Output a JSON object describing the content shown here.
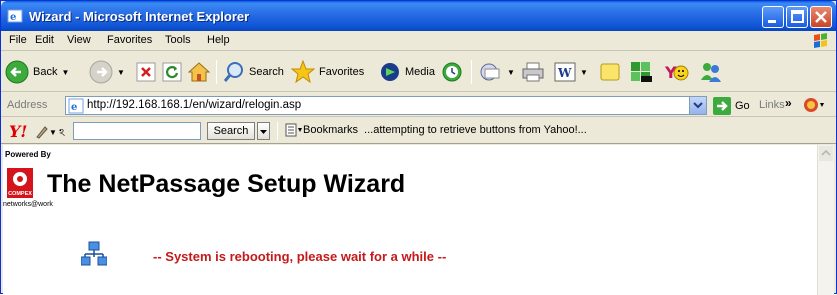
{
  "window": {
    "title": "Wizard - Microsoft Internet Explorer"
  },
  "menu": {
    "items": [
      "File",
      "Edit",
      "View",
      "Favorites",
      "Tools",
      "Help"
    ]
  },
  "toolbar": {
    "back_label": "Back",
    "search_label": "Search",
    "favorites_label": "Favorites",
    "media_label": "Media"
  },
  "address": {
    "label": "Address",
    "url": "http://192.168.168.1/en/wizard/relogin.asp",
    "go_label": "Go",
    "links_label": "Links"
  },
  "yahoo": {
    "logo": "Y!",
    "search_value": "",
    "search_button": "Search",
    "bookmarks_label": "Bookmarks",
    "status_text": "...attempting to retrieve buttons from Yahoo!..."
  },
  "page": {
    "powered_by": "Powered By",
    "logo_text": "COMPEX",
    "networks_text": "networks@work",
    "title": "The NetPassage Setup Wizard",
    "message": "-- System is rebooting, please wait for a while --"
  },
  "colors": {
    "title_bar": "#2a6fe6",
    "message": "#c41a1a"
  }
}
